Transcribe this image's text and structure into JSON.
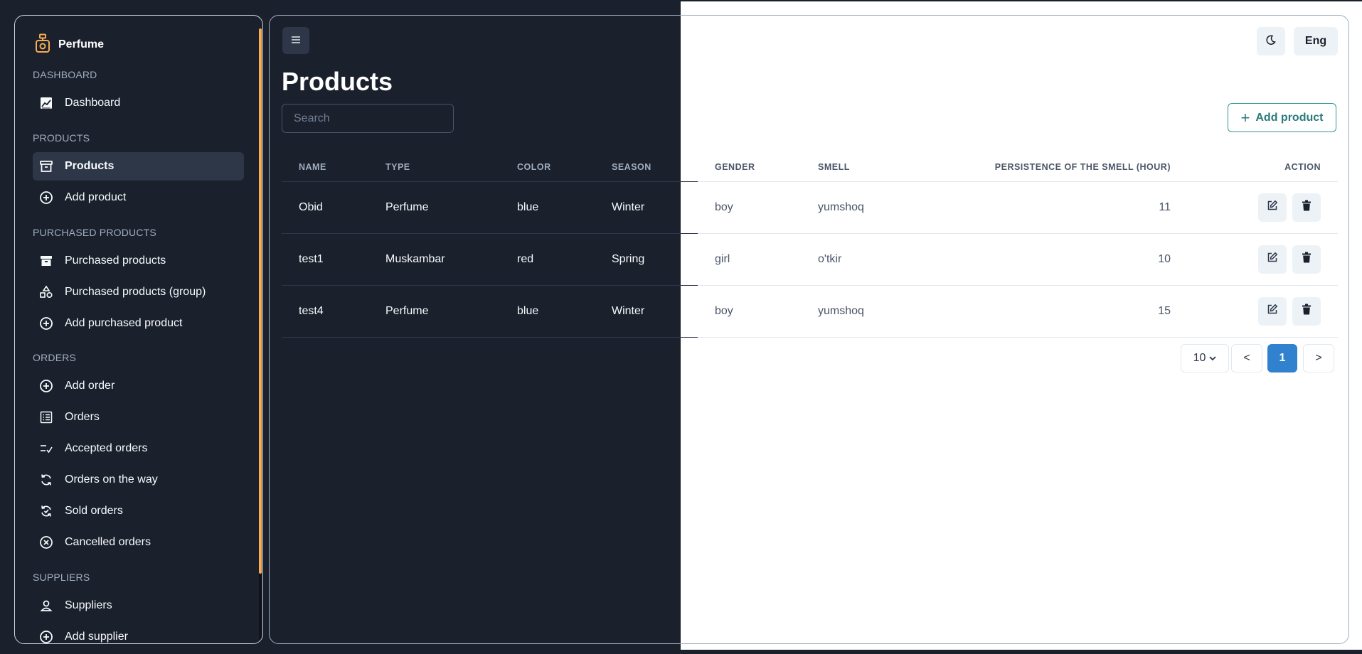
{
  "brand": {
    "name": "Perfume",
    "icon": "perfume-bottle-icon",
    "accent": "#f6ad55"
  },
  "sidebar": {
    "sections": [
      {
        "title": "DASHBOARD"
      },
      {
        "title": "PRODUCTS"
      },
      {
        "title": "PURCHASED PRODUCTS"
      },
      {
        "title": "ORDERS"
      },
      {
        "title": "SUPPLIERS"
      }
    ],
    "items": [
      {
        "label": "Dashboard",
        "icon": "chart-icon"
      },
      {
        "label": "Products",
        "icon": "archive-icon",
        "active": true
      },
      {
        "label": "Add product",
        "icon": "plus-circle-icon"
      },
      {
        "label": "Purchased products",
        "icon": "archive-filled-icon"
      },
      {
        "label": "Purchased products (group)",
        "icon": "shapes-icon"
      },
      {
        "label": "Add purchased product",
        "icon": "plus-circle-icon"
      },
      {
        "label": "Add order",
        "icon": "plus-circle-icon"
      },
      {
        "label": "Orders",
        "icon": "list-icon"
      },
      {
        "label": "Accepted orders",
        "icon": "list-check-icon"
      },
      {
        "label": "Orders on the way",
        "icon": "refresh-icon"
      },
      {
        "label": "Sold orders",
        "icon": "refresh-check-icon"
      },
      {
        "label": "Cancelled orders",
        "icon": "x-circle-icon"
      },
      {
        "label": "Suppliers",
        "icon": "user-icon"
      },
      {
        "label": "Add supplier",
        "icon": "plus-circle-icon"
      }
    ]
  },
  "header": {
    "menu_icon": "hamburger-icon",
    "theme_icon": "moon-icon",
    "language": "Eng"
  },
  "main": {
    "title": "Products",
    "search_placeholder": "Search",
    "add_button": "Add product",
    "columns": [
      "NAME",
      "TYPE",
      "COLOR",
      "SEASON",
      "GENDER",
      "SMELL",
      "PERSISTENCE OF THE SMELL (HOUR)",
      "ACTION"
    ],
    "rows": [
      {
        "name": "Obid",
        "type": "Perfume",
        "color": "blue",
        "season": "Winter",
        "gender": "boy",
        "smell": "yumshoq",
        "persistence": "11"
      },
      {
        "name": "test1",
        "type": "Muskambar",
        "color": "red",
        "season": "Spring",
        "gender": "girl",
        "smell": "o'tkir",
        "persistence": "10"
      },
      {
        "name": "test4",
        "type": "Perfume",
        "color": "blue",
        "season": "Winter",
        "gender": "boy",
        "smell": "yumshoq",
        "persistence": "15"
      }
    ],
    "row_actions": {
      "edit_icon": "edit-icon",
      "delete_icon": "trash-icon"
    },
    "pagination": {
      "page_size": "10",
      "prev": "<",
      "current": "1",
      "next": ">"
    }
  },
  "colors": {
    "active_page": "#3182ce",
    "add_button_border": "#319795"
  }
}
